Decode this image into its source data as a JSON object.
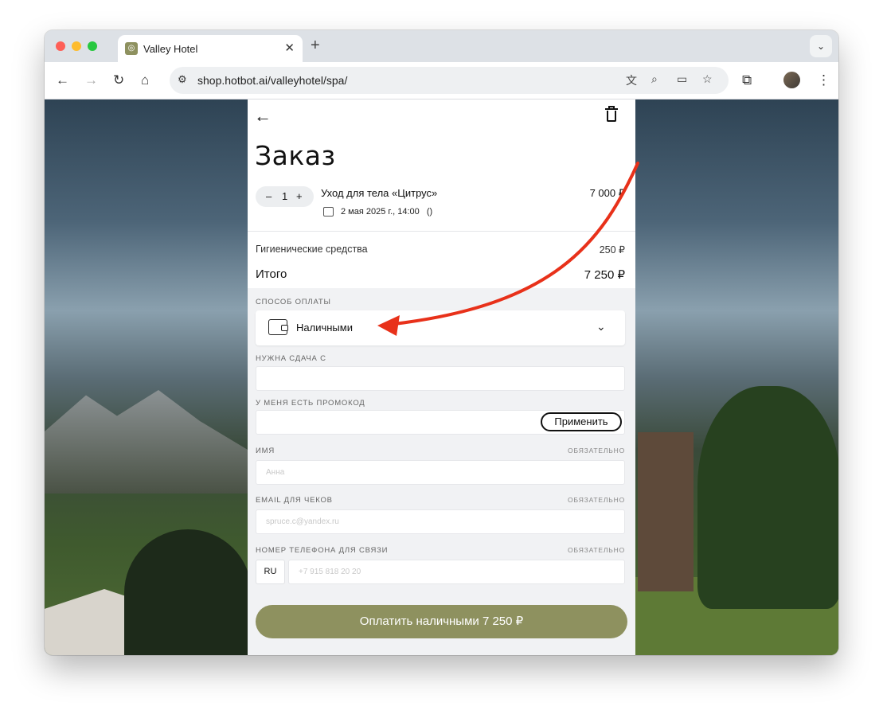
{
  "browser": {
    "tab_title": "Valley Hotel",
    "url": "shop.hotbot.ai/valleyhotel/spa/"
  },
  "order": {
    "title": "Заказ",
    "item": {
      "quantity": "1",
      "name": "Уход для тела «Цитрус»",
      "price": "7 000 ₽",
      "date": "2 мая 2025 г., 14:00",
      "date_suffix": "()"
    },
    "hygiene_label": "Гигиенические средства",
    "hygiene_price": "250 ₽",
    "total_label": "Итого",
    "total_value": "7 250 ₽"
  },
  "form": {
    "payment_method_label": "СПОСОБ ОПЛАТЫ",
    "payment_method_value": "Наличными",
    "change_label": "НУЖНА СДАЧА С",
    "promo_label": "У МЕНЯ ЕСТЬ ПРОМОКОД",
    "apply_label": "Применить",
    "name_label": "ИМЯ",
    "name_placeholder": "Анна",
    "email_label": "EMAIL ДЛЯ ЧЕКОВ",
    "email_placeholder": "spruce.c@yandex.ru",
    "phone_label": "НОМЕР ТЕЛЕФОНА ДЛЯ СВЯЗИ",
    "phone_country": "RU",
    "phone_placeholder": "+7 915 818 20 20",
    "required_label": "ОБЯЗАТЕЛЬНО",
    "submit_label": "Оплатить наличными 7 250 ₽"
  },
  "colors": {
    "accent": "#8e915f",
    "annotation_arrow": "#e8311a"
  },
  "icons": [
    "back-arrow-icon",
    "trash-icon",
    "calendar-icon",
    "wallet-icon",
    "chevron-down-icon"
  ]
}
